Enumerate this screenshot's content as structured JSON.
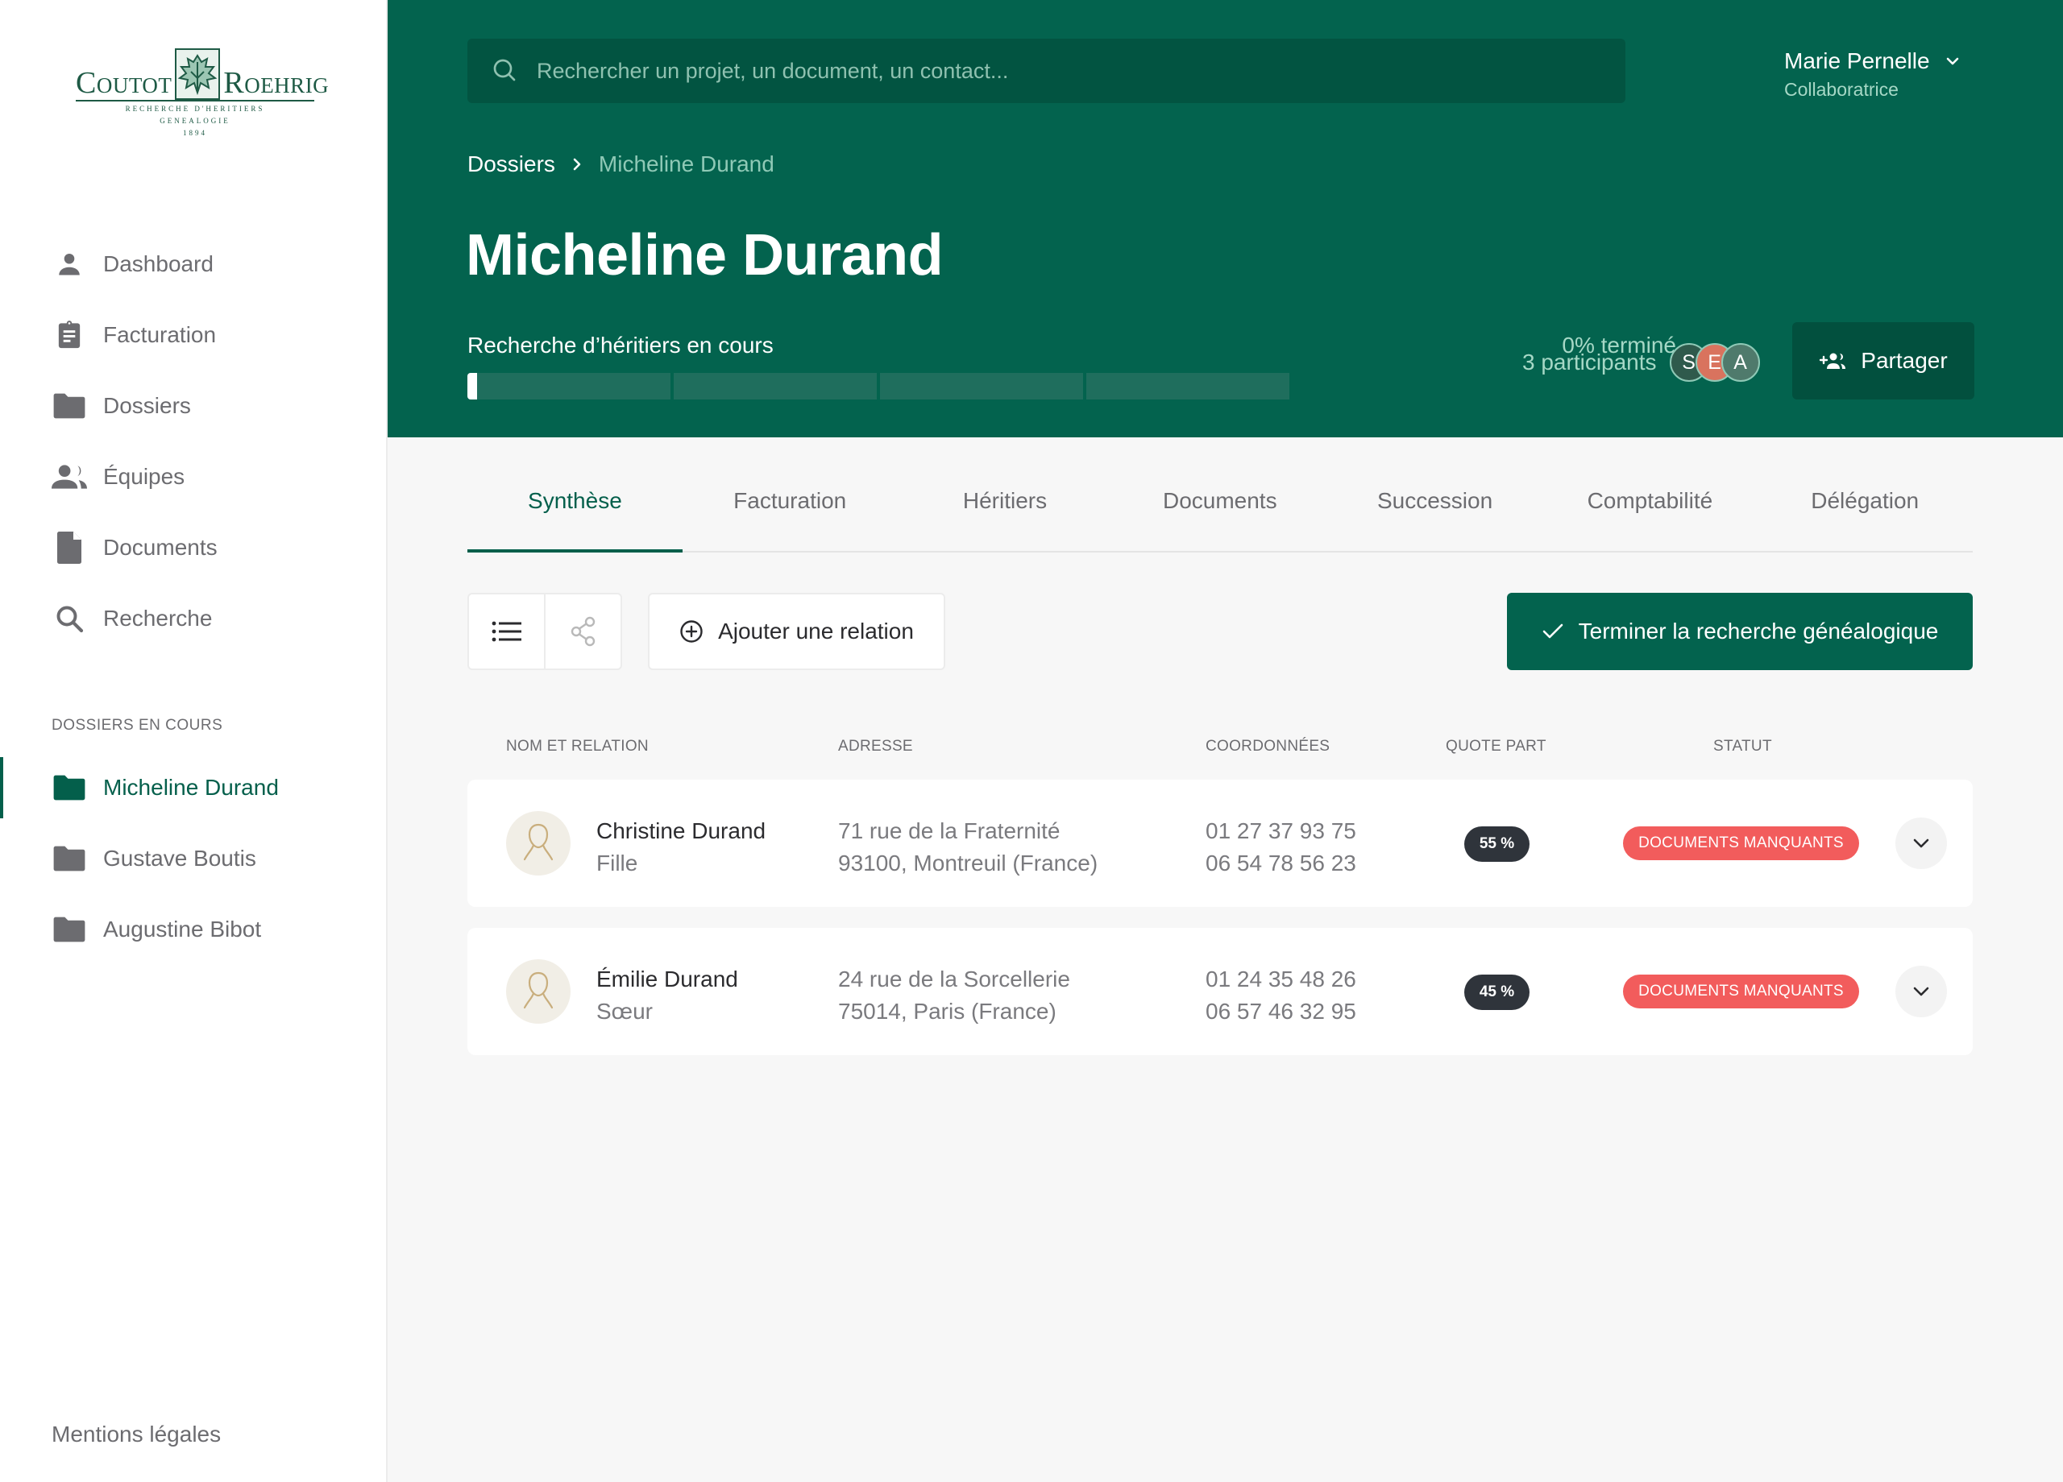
{
  "brand": {
    "logo_left": "Coutot",
    "logo_right": "Roehrig",
    "logo_tagline_1": "RECHERCHE D'HERITIERS",
    "logo_tagline_2": "GENEALOGIE",
    "logo_year": "1894"
  },
  "sidebar": {
    "items": [
      {
        "label": "Dashboard",
        "icon": "person-icon"
      },
      {
        "label": "Facturation",
        "icon": "clipboard-icon"
      },
      {
        "label": "Dossiers",
        "icon": "folder-icon"
      },
      {
        "label": "Équipes",
        "icon": "group-icon"
      },
      {
        "label": "Documents",
        "icon": "document-icon"
      },
      {
        "label": "Recherche",
        "icon": "search-icon"
      }
    ],
    "section_title": "DOSSIERS EN COURS",
    "dossiers": [
      {
        "label": "Micheline Durand",
        "active": true
      },
      {
        "label": "Gustave Boutis",
        "active": false
      },
      {
        "label": "Augustine Bibot",
        "active": false
      }
    ],
    "footer_link": "Mentions légales"
  },
  "header": {
    "search_placeholder": "Rechercher un projet, un document, un contact...",
    "search_value": "",
    "user_name": "Marie Pernelle",
    "user_role": "Collaboratrice",
    "breadcrumb": {
      "parent": "Dossiers",
      "current": "Micheline Durand"
    },
    "title": "Micheline Durand",
    "progress_label": "Recherche d’héritiers en cours",
    "progress_text": "0% terminé",
    "progress_value": 0,
    "progress_segments": 4,
    "participants_label": "3 participants",
    "participants": [
      {
        "initial": "S",
        "color": "#2f5a4c"
      },
      {
        "initial": "E",
        "color": "#d9735e"
      },
      {
        "initial": "A",
        "color": "#4f7a6c"
      }
    ],
    "share_label": "Partager"
  },
  "tabs": [
    {
      "label": "Synthèse",
      "active": true
    },
    {
      "label": "Facturation",
      "active": false
    },
    {
      "label": "Héritiers",
      "active": false
    },
    {
      "label": "Documents",
      "active": false
    },
    {
      "label": "Succession",
      "active": false
    },
    {
      "label": "Comptabilité",
      "active": false
    },
    {
      "label": "Délégation",
      "active": false
    }
  ],
  "toolbar": {
    "list_view_icon": "list-icon",
    "tree_view_icon": "tree-icon",
    "add_relation_label": "Ajouter une relation",
    "finish_label": "Terminer la recherche généalogique"
  },
  "table": {
    "headers": [
      "NOM ET RELATION",
      "ADRESSE",
      "COORDONNÉES",
      "QUOTE PART",
      "STATUT"
    ],
    "rows": [
      {
        "name": "Christine Durand",
        "relation": "Fille",
        "address_line1": "71 rue de la Fraternité",
        "address_line2": "93100, Montreuil (France)",
        "phone1": "01 27 37 93 75",
        "phone2": "06 54 78 56 23",
        "quota": "55 %",
        "status": "DOCUMENTS MANQUANTS"
      },
      {
        "name": "Émilie Durand",
        "relation": "Sœur",
        "address_line1": "24 rue de la Sorcellerie",
        "address_line2": "75014, Paris (France)",
        "phone1": "01 24 35 48 26",
        "phone2": "06 57 46 32 95",
        "quota": "45 %",
        "status": "DOCUMENTS MANQUANTS"
      }
    ]
  },
  "colors": {
    "brand_green": "#03634e",
    "brand_green_dark": "#025441",
    "status_red": "#f25c5c",
    "quota_dark": "#2f343b"
  }
}
